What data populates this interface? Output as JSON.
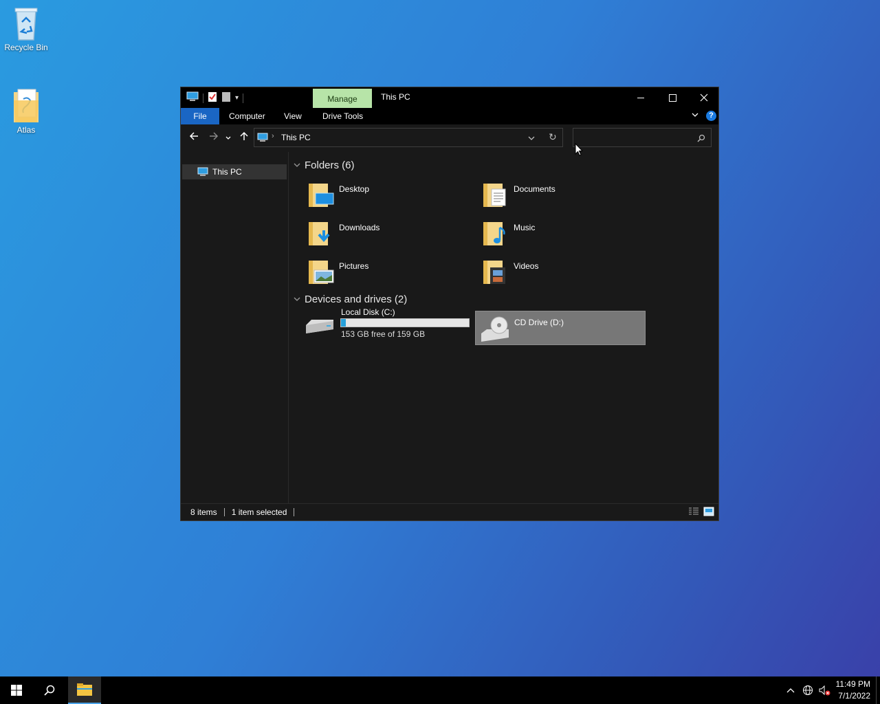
{
  "desktop": {
    "icons": [
      {
        "label": "Recycle Bin",
        "icon": "recycle-bin-icon"
      },
      {
        "label": "Atlas",
        "icon": "folder-icon"
      }
    ]
  },
  "window": {
    "title": "This PC",
    "manage_tab": "Manage",
    "ribbon_tabs": [
      "File",
      "Computer",
      "View",
      "Drive Tools"
    ],
    "address": "This PC",
    "search_placeholder": "",
    "nav_pane": {
      "selected": "This PC"
    },
    "groups": {
      "folders": {
        "title": "Folders (6)"
      },
      "devices": {
        "title": "Devices and drives (2)"
      }
    },
    "folders": [
      {
        "label": "Desktop",
        "icon": "desktop-folder-icon"
      },
      {
        "label": "Documents",
        "icon": "documents-folder-icon"
      },
      {
        "label": "Downloads",
        "icon": "downloads-folder-icon"
      },
      {
        "label": "Music",
        "icon": "music-folder-icon"
      },
      {
        "label": "Pictures",
        "icon": "pictures-folder-icon"
      },
      {
        "label": "Videos",
        "icon": "videos-folder-icon"
      }
    ],
    "drives": [
      {
        "label": "Local Disk (C:)",
        "free_text": "153 GB free of 159 GB",
        "used_fraction": 0.038,
        "icon": "hard-drive-icon"
      },
      {
        "label": "CD Drive (D:)",
        "icon": "cd-drive-icon",
        "selected": true
      }
    ],
    "status": {
      "items": "8 items",
      "selected": "1 item selected"
    }
  },
  "taskbar": {
    "time": "11:49 PM",
    "date": "7/1/2022"
  },
  "colors": {
    "accent": "#1a66c4",
    "manage_tab": "#b7e4a8",
    "drive_bar": "#26a0da"
  }
}
